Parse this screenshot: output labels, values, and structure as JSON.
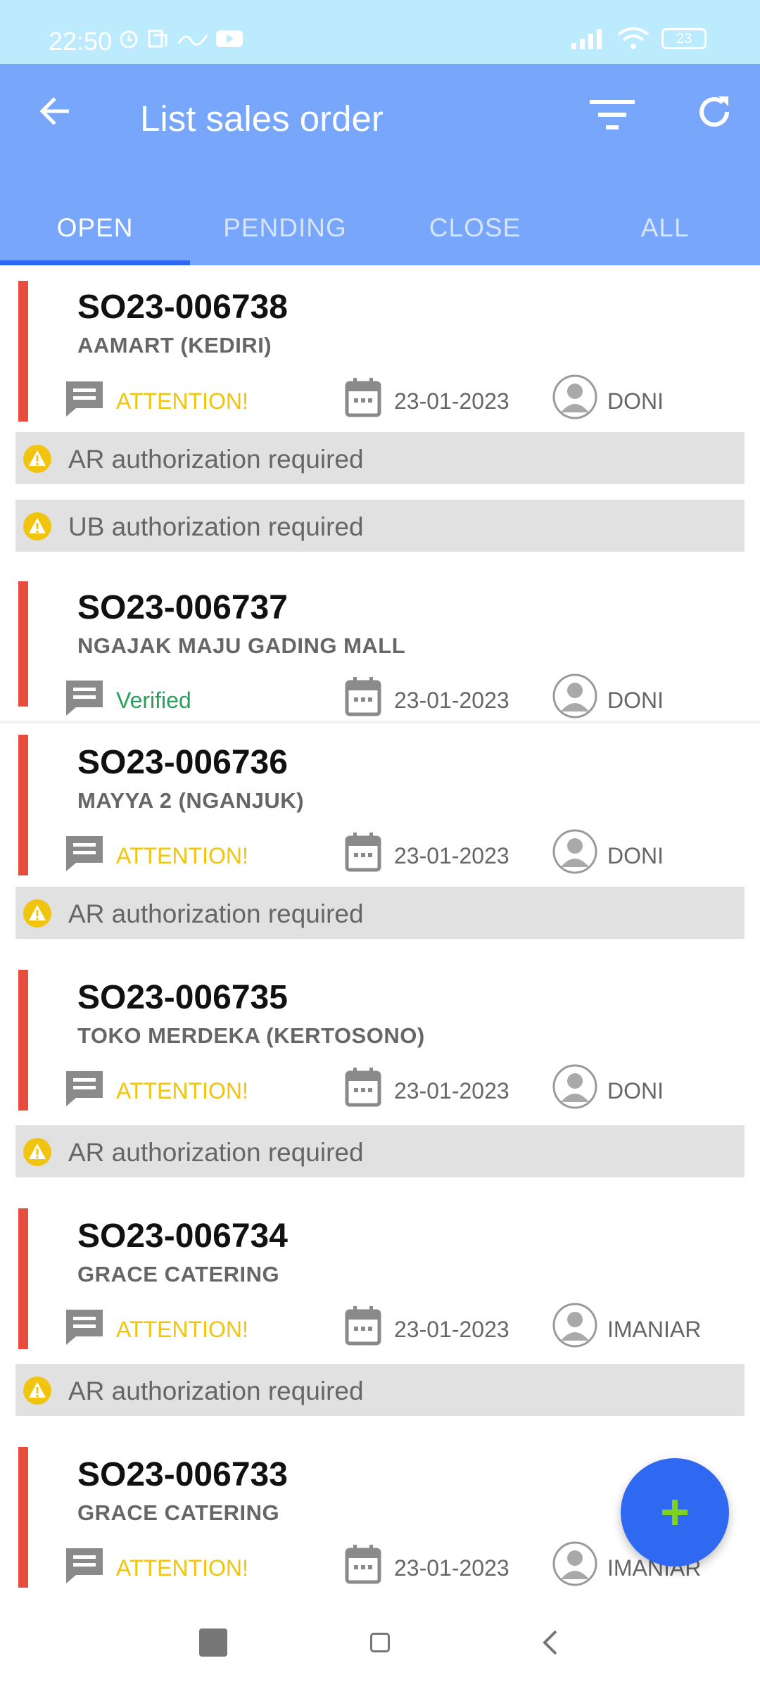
{
  "status_bar": {
    "time": "22:50",
    "battery": "23"
  },
  "app_bar": {
    "title": "List sales order"
  },
  "tabs": [
    {
      "label": "OPEN",
      "active": true
    },
    {
      "label": "PENDING",
      "active": false
    },
    {
      "label": "CLOSE",
      "active": false
    },
    {
      "label": "ALL",
      "active": false
    }
  ],
  "orders": [
    {
      "so": "SO23-006738",
      "customer": "AAMART (KEDIRI)",
      "status": "ATTENTION!",
      "date": "23-01-2023",
      "user": "DONI",
      "warnings": [
        "AR authorization required",
        "UB authorization required"
      ]
    },
    {
      "so": "SO23-006737",
      "customer": "NGAJAK MAJU GADING MALL",
      "status": "Verified",
      "date": "23-01-2023",
      "user": "DONI",
      "warnings": []
    },
    {
      "so": "SO23-006736",
      "customer": "MAYYA 2 (NGANJUK)",
      "status": "ATTENTION!",
      "date": "23-01-2023",
      "user": "DONI",
      "warnings": [
        "AR authorization required"
      ]
    },
    {
      "so": "SO23-006735",
      "customer": "TOKO MERDEKA (KERTOSONO)",
      "status": "ATTENTION!",
      "date": "23-01-2023",
      "user": "DONI",
      "warnings": [
        "AR authorization required"
      ]
    },
    {
      "so": "SO23-006734",
      "customer": "GRACE CATERING",
      "status": "ATTENTION!",
      "date": "23-01-2023",
      "user": "IMANIAR",
      "warnings": [
        "AR authorization required"
      ]
    },
    {
      "so": "SO23-006733",
      "customer": "GRACE CATERING",
      "status": "ATTENTION!",
      "date": "23-01-2023",
      "user": "IMANIAR",
      "warnings": []
    }
  ],
  "colors": {
    "app_bar": "#78a6fa",
    "accent": "#2f69f2",
    "attention": "#f1c40f",
    "verified": "#27a15a",
    "urgency_bar": "#e74c3c",
    "fab_plus": "#7ed321"
  },
  "icons": {
    "back": "arrow-left-icon",
    "filter": "filter-icon",
    "refresh": "refresh-icon",
    "status": "message-icon",
    "date": "calendar-icon",
    "user": "avatar-icon",
    "warning": "warning-icon",
    "fab": "plus-icon"
  }
}
